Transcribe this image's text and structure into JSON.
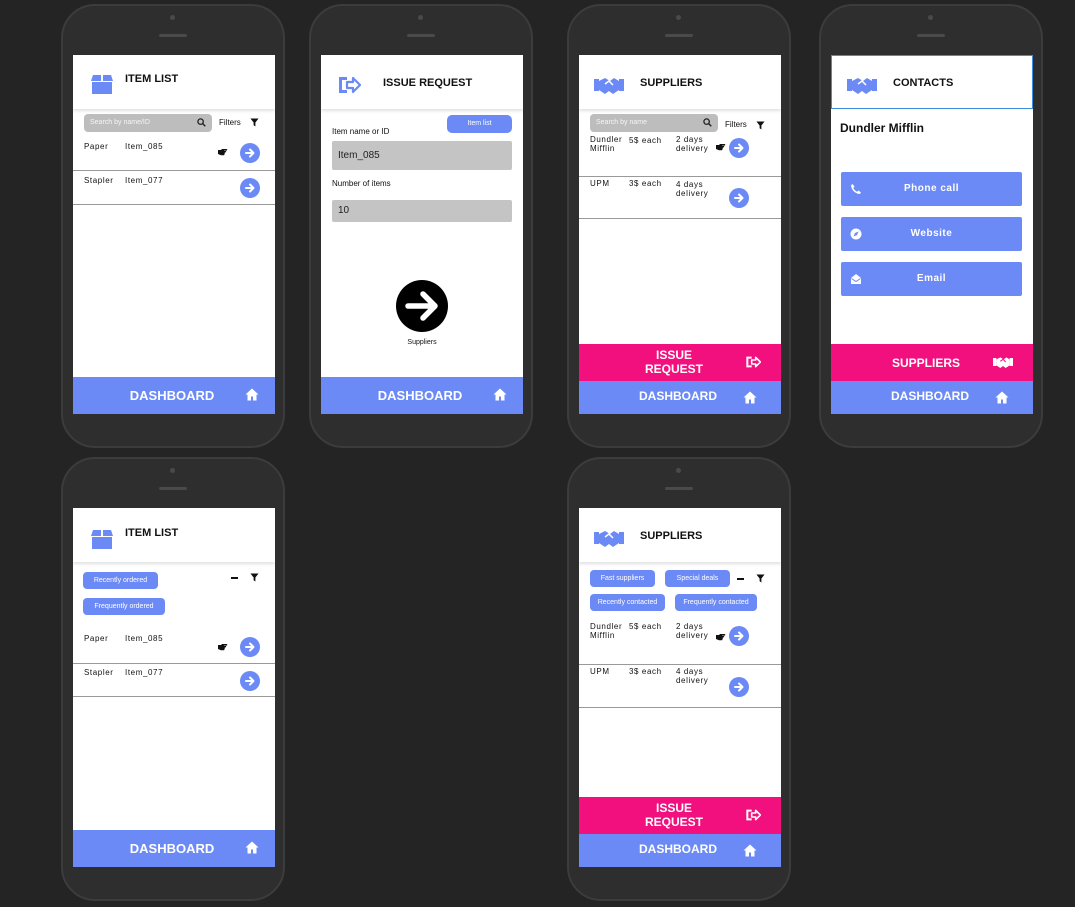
{
  "colors": {
    "accent": "#6b8af5",
    "pink": "#f20f7e",
    "background": "#242424"
  },
  "common": {
    "dashboard_label": "DASHBOARD",
    "filters_label": "Filters"
  },
  "item_list": {
    "title": "ITEM LIST",
    "search_placeholder": "Search by name/ID",
    "rows": [
      {
        "name": "Paper",
        "id": "Item_085"
      },
      {
        "name": "Stapler",
        "id": "Item_077"
      }
    ]
  },
  "item_list_filtered": {
    "title": "ITEM LIST",
    "chips": [
      "Recently ordered",
      "Frequently ordered"
    ],
    "rows": [
      {
        "name": "Paper",
        "id": "Item_085"
      },
      {
        "name": "Stapler",
        "id": "Item_077"
      }
    ]
  },
  "issue_request": {
    "title": "ISSUE REQUEST",
    "item_list_button": "Item list",
    "item_label": "Item name or ID",
    "item_value": "Item_085",
    "count_label": "Number of items",
    "count_value": "10",
    "next_label": "Suppliers"
  },
  "suppliers": {
    "title": "SUPPLIERS",
    "search_placeholder": "Search by name",
    "rows": [
      {
        "name_line1": "Dundler",
        "name_line2": "Mifflin",
        "price": "5$ each",
        "delivery_line1": "2 days",
        "delivery_line2": "delivery"
      },
      {
        "name_line1": "UPM",
        "name_line2": "",
        "price": "3$ each",
        "delivery_line1": "4 days",
        "delivery_line2": "delivery"
      }
    ],
    "issue_label_line1": "ISSUE",
    "issue_label_line2": "REQUEST"
  },
  "suppliers_filtered": {
    "title": "SUPPLIERS",
    "chips": [
      "Fast suppliers",
      "Special deals",
      "Recently contacted",
      "Frequently contacted"
    ],
    "rows": [
      {
        "name_line1": "Dundler",
        "name_line2": "Mifflin",
        "price": "5$ each",
        "delivery_line1": "2 days",
        "delivery_line2": "delivery"
      },
      {
        "name_line1": "UPM",
        "name_line2": "",
        "price": "3$ each",
        "delivery_line1": "4 days",
        "delivery_line2": "delivery"
      }
    ],
    "issue_label_line1": "ISSUE",
    "issue_label_line2": "REQUEST"
  },
  "contacts": {
    "title": "CONTACTS",
    "company": "Dundler Mifflin",
    "buttons": [
      "Phone call",
      "Website",
      "Email"
    ],
    "suppliers_label": "SUPPLIERS"
  }
}
